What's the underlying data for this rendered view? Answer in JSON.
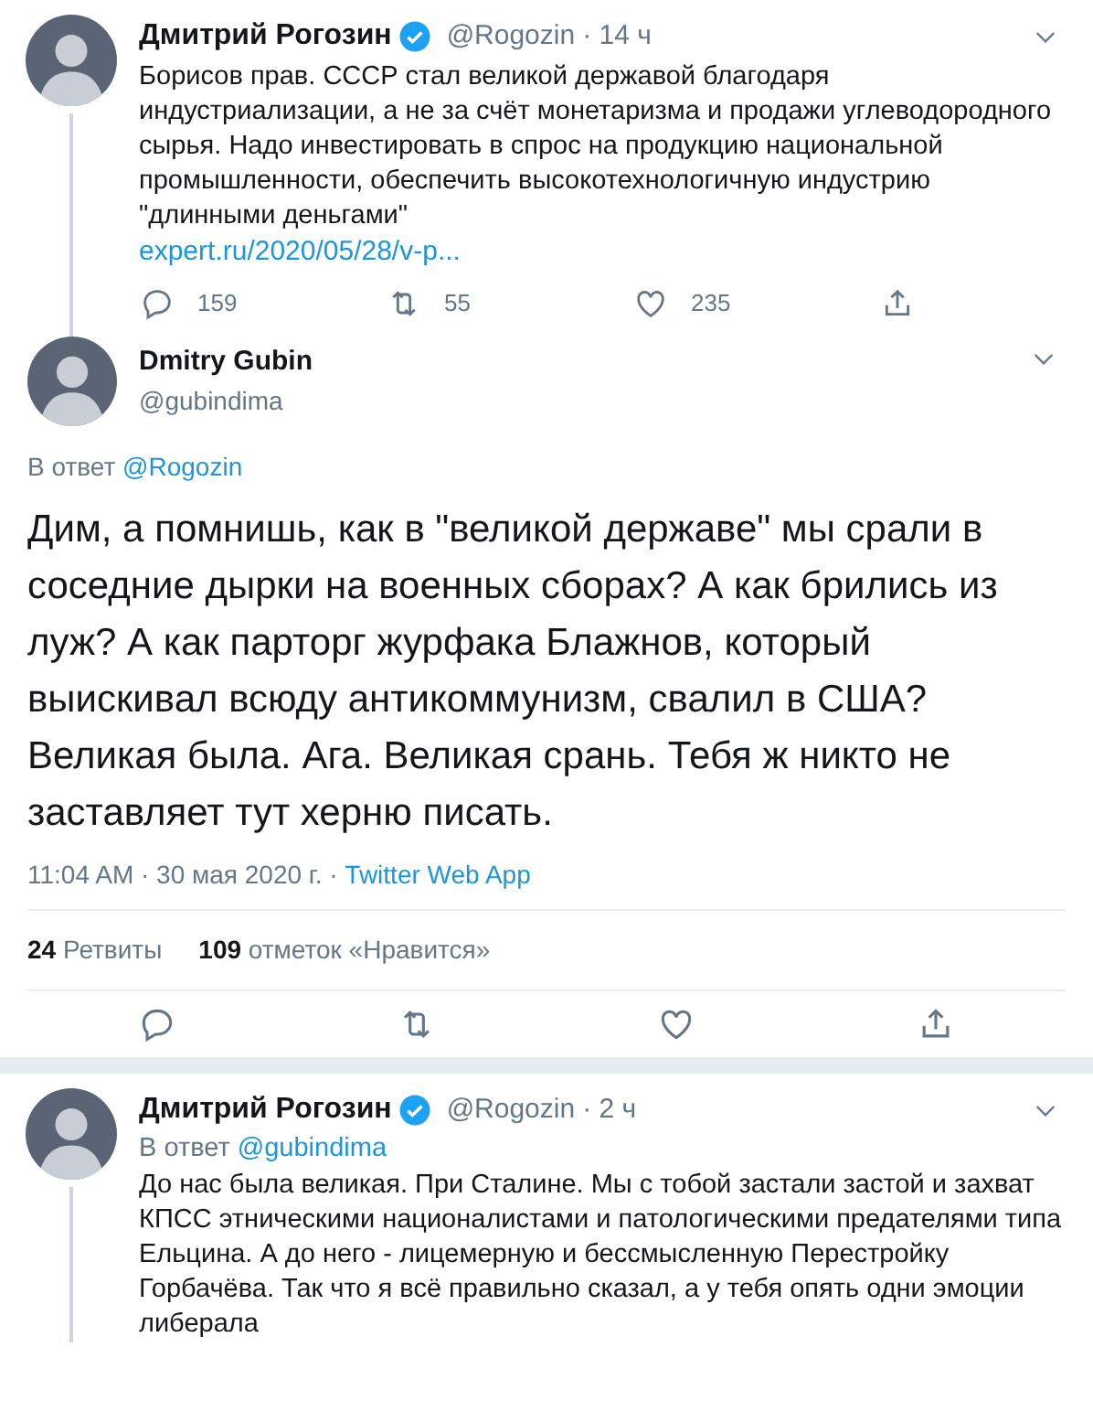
{
  "tweets": [
    {
      "kind": "thread",
      "name": "Дмитрий Рогозин",
      "verified": true,
      "handle": "@Rogozin",
      "time": "· 14 ч",
      "thread_line": true,
      "text": "Борисов прав. СССР стал великой державой благодаря индустриализации, а не за счёт монетаризма и продажи углеводородного сырья. Надо инвестировать в спрос на продукцию национальной промышленности, обеспечить высокотехнологичную индустрию \"длинными деньгами\"",
      "link": "expert.ru/2020/05/28/v-p...",
      "actions": {
        "replies": "159",
        "retweets": "55",
        "likes": "235"
      }
    },
    {
      "kind": "focus",
      "name": "Dmitry Gubin",
      "handle": "@gubindima",
      "reply_label": "В ответ",
      "reply_to": "@Rogozin",
      "text": "Дим, а помнишь, как в \"великой державе\" мы срали в соседние дырки на военных сборах? А как брились из луж? А как парторг журфака Блажнов, который выискивал всюду антикоммунизм, свалил в США? Великая была. Ага. Великая срань. Тебя ж никто не заставляет тут херню писать.",
      "timestamp": "11:04 AM · 30 мая 2020 г. ·",
      "source": "Twitter Web App",
      "stats": [
        {
          "count": "24",
          "label": "Ретвиты"
        },
        {
          "count": "109",
          "label": "отметок «Нравится»"
        }
      ]
    },
    {
      "kind": "reply",
      "name": "Дмитрий Рогозин",
      "verified": true,
      "handle": "@Rogozin",
      "time": "· 2 ч",
      "thread_line": true,
      "reply_label": "В ответ",
      "reply_to": "@gubindima",
      "text": "До нас была великая. При Сталине. Мы с тобой застали застой и захват КПСС этническими националистами и патологическими предателями типа Ельцина. А до него - лицемерную и бессмысленную Перестройку Горбачёва. Так что я всё правильно сказал, а у тебя опять одни эмоции либерала"
    }
  ]
}
